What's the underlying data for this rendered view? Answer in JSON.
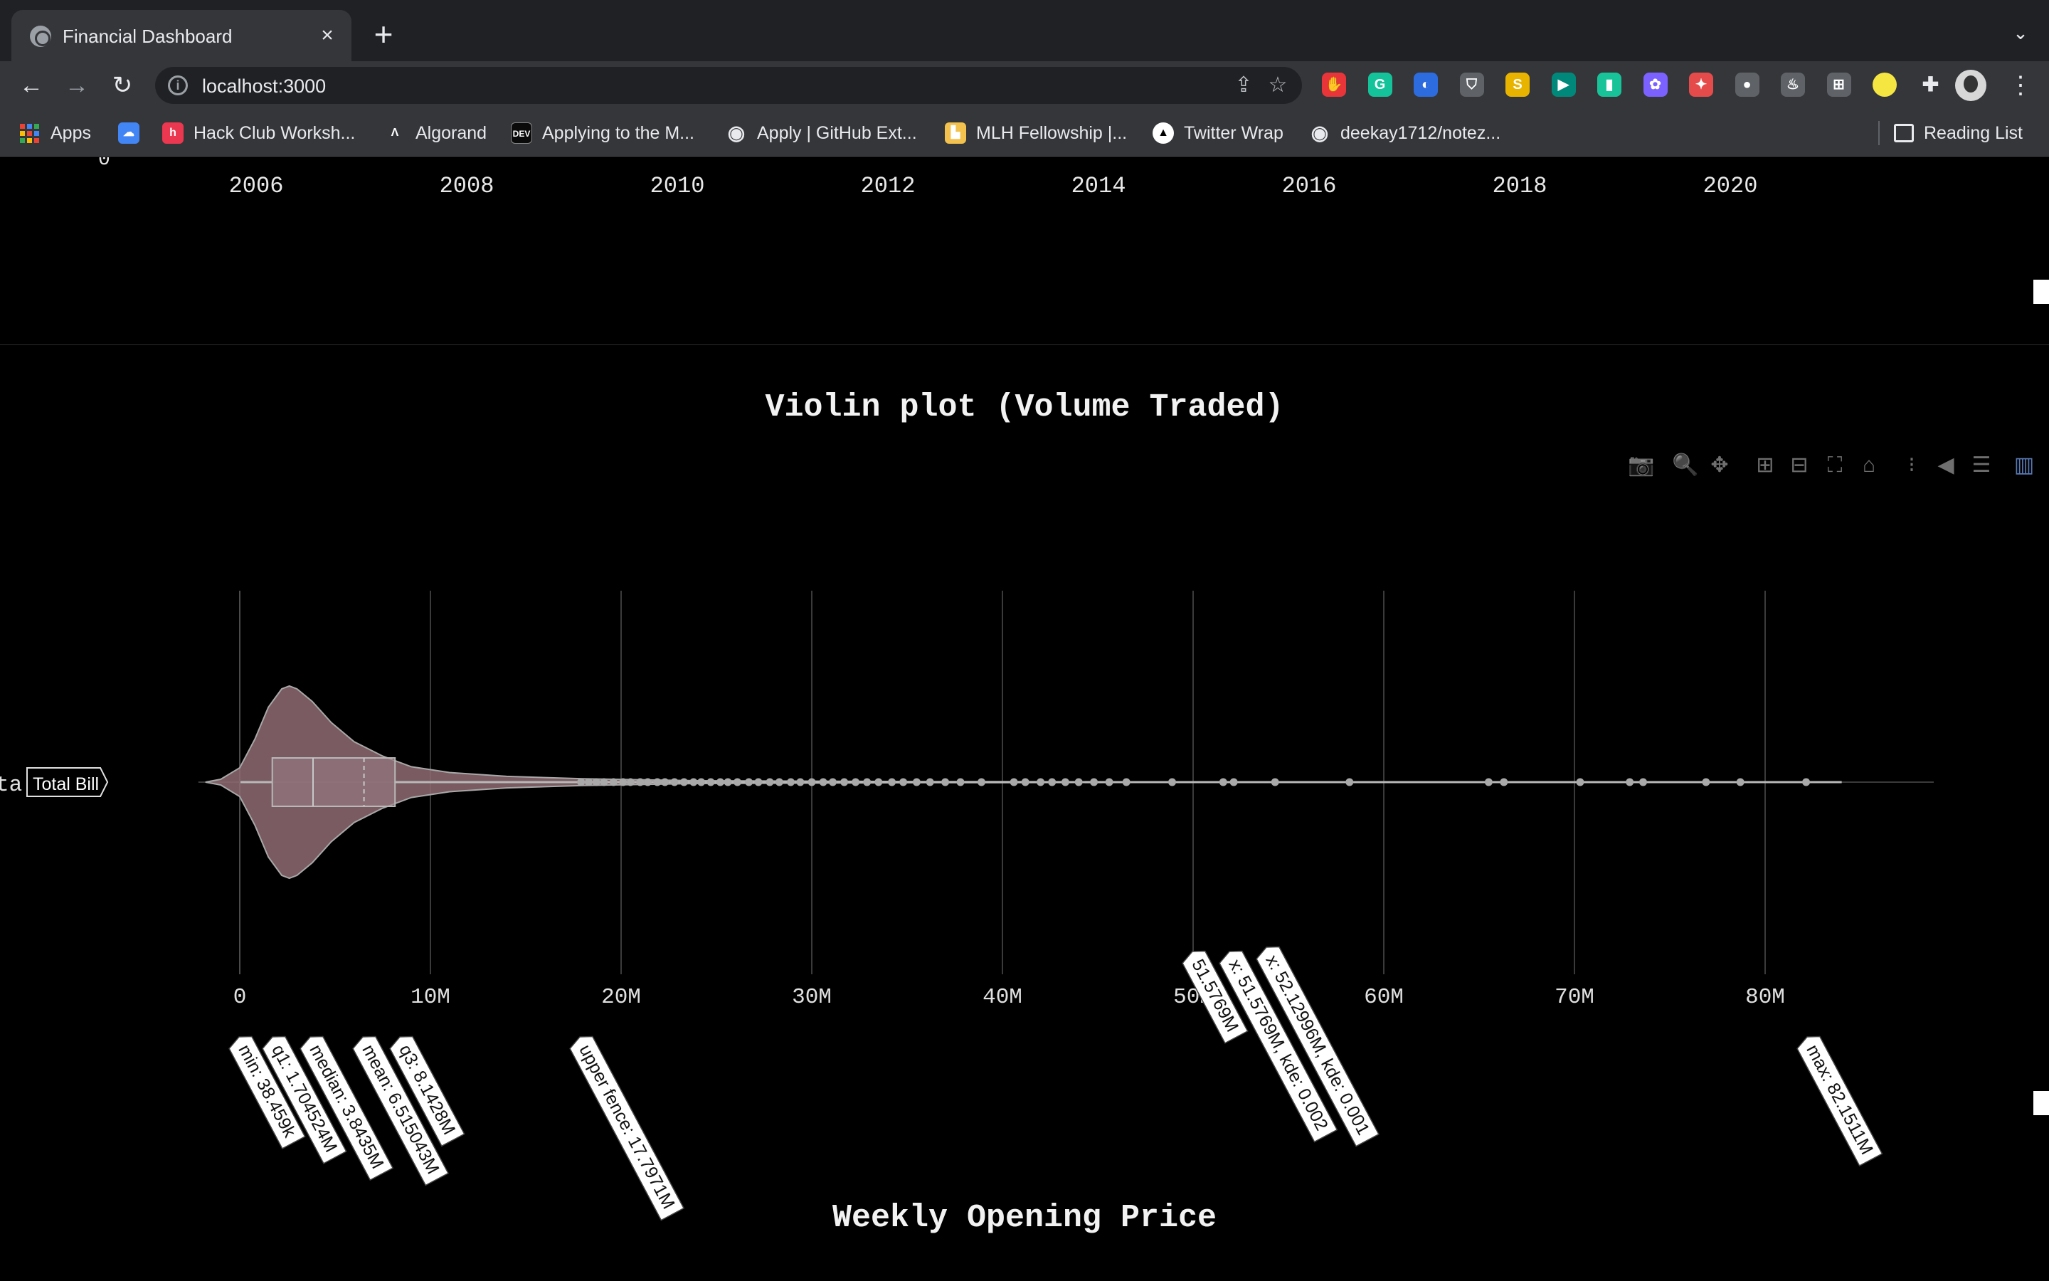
{
  "browser": {
    "tab_title": "Financial Dashboard",
    "tab_close": "×",
    "new_tab": "+",
    "tab_search": "⌄",
    "url": "localhost:3000",
    "back": "←",
    "forward": "→",
    "reload": "↻",
    "share": "⇪",
    "star": "☆",
    "menu": "⋮"
  },
  "extensions": [
    {
      "name": "ext-red-hand-icon",
      "color": "#e8353a",
      "glyph": "✋"
    },
    {
      "name": "ext-grammarly-icon",
      "color": "#15c39a",
      "glyph": "G"
    },
    {
      "name": "ext-flame-icon",
      "color": "#2d6cdf",
      "glyph": "◐"
    },
    {
      "name": "ext-shield-icon",
      "color": "#5f6368",
      "glyph": "⛉"
    },
    {
      "name": "ext-scribe-icon",
      "color": "#e8b400",
      "glyph": "S"
    },
    {
      "name": "ext-meet-icon",
      "color": "#00897b",
      "glyph": "▶"
    },
    {
      "name": "ext-bookmark-icon",
      "color": "#19c39a",
      "glyph": "▮"
    },
    {
      "name": "ext-colorwheel-icon",
      "color": "#7b61ff",
      "glyph": "✿"
    },
    {
      "name": "ext-gift-icon",
      "color": "#e54b4b",
      "glyph": "✦"
    },
    {
      "name": "ext-panda-icon",
      "color": "#5f6368",
      "glyph": "●"
    },
    {
      "name": "ext-coffee-icon",
      "color": "#5f6368",
      "glyph": "♨"
    },
    {
      "name": "ext-cart-icon",
      "color": "#5f6368",
      "glyph": "⊞"
    },
    {
      "name": "ext-yellow-dot-icon",
      "color": "#f5e642",
      "glyph": ""
    },
    {
      "name": "extensions-puzzle-icon",
      "color": "#35363a",
      "glyph": "✚"
    }
  ],
  "bookmarks": [
    {
      "label": "Apps",
      "icon": "apps-grid-icon"
    },
    {
      "label": "",
      "icon": "google-cloud-icon",
      "color": "#4285f4",
      "glyph": "☁"
    },
    {
      "label": "Hack Club Worksh...",
      "icon": "hackclub-icon",
      "color": "#ec3750",
      "glyph": "h"
    },
    {
      "label": "Algorand",
      "icon": "algorand-icon",
      "color": "#35363a",
      "glyph": "Λ"
    },
    {
      "label": "Applying to the M...",
      "icon": "dev-icon",
      "color": "#0a0a0a",
      "glyph": "DEV"
    },
    {
      "label": "Apply | GitHub Ext...",
      "icon": "github-icon",
      "color": "#e8eaed",
      "glyph": "◉"
    },
    {
      "label": "MLH Fellowship |...",
      "icon": "mlh-icon",
      "color": "#f2c14e",
      "glyph": "▙"
    },
    {
      "label": "Twitter Wrap",
      "icon": "twitter-wrap-icon",
      "color": "#ffffff",
      "glyph": "▲"
    },
    {
      "label": "deekay1712/notez...",
      "icon": "github-icon",
      "color": "#e8eaed",
      "glyph": "◉"
    }
  ],
  "reading_list": "Reading List",
  "previous_chart": {
    "x_ticks": [
      "2006",
      "2008",
      "2010",
      "2012",
      "2014",
      "2016",
      "2018",
      "2020"
    ],
    "clipped_y_tick": "0"
  },
  "modebar": [
    {
      "name": "camera-icon",
      "glyph": "📷"
    },
    {
      "name": "zoom-icon",
      "glyph": "🔍"
    },
    {
      "name": "pan-icon",
      "glyph": "✥"
    },
    {
      "name": "zoom-in-icon",
      "glyph": "⊞"
    },
    {
      "name": "zoom-out-icon",
      "glyph": "⊟"
    },
    {
      "name": "autoscale-icon",
      "glyph": "⛶"
    },
    {
      "name": "reset-axes-icon",
      "glyph": "⌂"
    },
    {
      "name": "spike-lines-icon",
      "glyph": "⁝"
    },
    {
      "name": "hover-closest-icon",
      "glyph": "◀"
    },
    {
      "name": "hover-compare-icon",
      "glyph": "☰"
    },
    {
      "name": "plotly-logo-icon",
      "glyph": "▥"
    }
  ],
  "chart_data": {
    "type": "violin",
    "title": "Violin plot (Volume Traded)",
    "orientation": "horizontal",
    "y_category": "Total Bill",
    "y_axis_clipped_text": "ta",
    "x_ticks": [
      {
        "value": 0,
        "label": "0"
      },
      {
        "value": 10000000,
        "label": "10M"
      },
      {
        "value": 20000000,
        "label": "20M"
      },
      {
        "value": 30000000,
        "label": "30M"
      },
      {
        "value": 40000000,
        "label": "40M"
      },
      {
        "value": 50000000,
        "label": "50M"
      },
      {
        "value": 60000000,
        "label": "60M"
      },
      {
        "value": 70000000,
        "label": "70M"
      },
      {
        "value": 80000000,
        "label": "80M"
      }
    ],
    "xlim": [
      -1800000,
      89000000
    ],
    "fill_color": "#8e6b72",
    "line_color": "#a8a8a8",
    "stats": {
      "min": 38459,
      "q1": 1704524,
      "median": 3843500,
      "mean": 6515043,
      "q3": 8142800,
      "upper_fence": 17797100,
      "max": 82151100
    },
    "hover_labels": [
      {
        "key": "min",
        "text": "min: 38.459k"
      },
      {
        "key": "q1",
        "text": "q1: 1.704524M"
      },
      {
        "key": "median",
        "text": "median: 3.8435M"
      },
      {
        "key": "mean",
        "text": "mean: 6.515043M"
      },
      {
        "key": "q3",
        "text": "q3: 8.1428M"
      },
      {
        "key": "upper_fence",
        "text": "upper fence: 17.7971M"
      },
      {
        "key": "max",
        "text": "max: 82.1511M"
      }
    ],
    "point_labels": [
      {
        "x": 51576900,
        "text": "51.5769M"
      },
      {
        "x": 51576900,
        "text": "x: 51.5769M, kde: 0.002"
      },
      {
        "x": 52129960,
        "text": "x: 52.12996M, kde: 0.001"
      }
    ],
    "category_label": "Total Bill",
    "density": [
      [
        -1800000,
        0.0
      ],
      [
        -1000000,
        0.03
      ],
      [
        0,
        0.15
      ],
      [
        800000,
        0.45
      ],
      [
        1500000,
        0.78
      ],
      [
        2200000,
        0.97
      ],
      [
        2600000,
        1.0
      ],
      [
        3000000,
        0.97
      ],
      [
        3800000,
        0.84
      ],
      [
        4800000,
        0.62
      ],
      [
        6000000,
        0.42
      ],
      [
        7500000,
        0.27
      ],
      [
        9000000,
        0.16
      ],
      [
        11000000,
        0.1
      ],
      [
        14000000,
        0.06
      ],
      [
        18000000,
        0.035
      ],
      [
        24000000,
        0.015
      ],
      [
        36000000,
        0.006
      ],
      [
        50000000,
        0.003
      ],
      [
        70000000,
        0.002
      ],
      [
        84000000,
        0.0
      ]
    ],
    "outliers": [
      17900000,
      18300000,
      18700000,
      19100000,
      19600000,
      20100000,
      20500000,
      21000000,
      21400000,
      21900000,
      22300000,
      22800000,
      23300000,
      23800000,
      24200000,
      24700000,
      25200000,
      25600000,
      26100000,
      26700000,
      27200000,
      27800000,
      28300000,
      28900000,
      29400000,
      30000000,
      30600000,
      31100000,
      31700000,
      32300000,
      32900000,
      33500000,
      34200000,
      34800000,
      35500000,
      36200000,
      37000000,
      37800000,
      38900000,
      40600000,
      41200000,
      42000000,
      42600000,
      43300000,
      44000000,
      44800000,
      45600000,
      46500000,
      48900000,
      51576900,
      52129960,
      54300000,
      58200000,
      65500000,
      66300000,
      70300000,
      72900000,
      73600000,
      76900000,
      78700000,
      82151100
    ]
  },
  "next_chart": {
    "title": "Weekly Opening Price"
  }
}
